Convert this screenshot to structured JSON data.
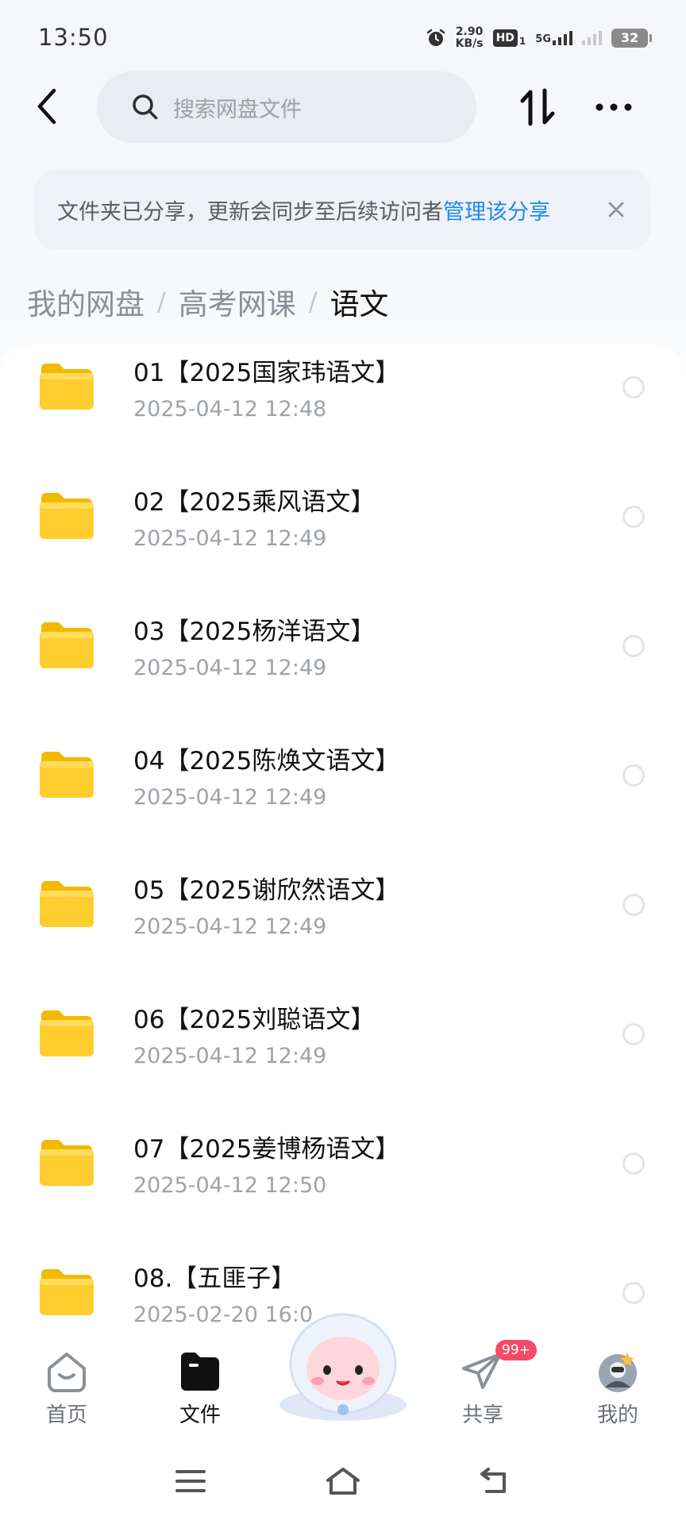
{
  "status_bar": {
    "time": "13:50",
    "net_speed_value": "2.90",
    "net_speed_unit": "KB/s",
    "hd_label": "HD",
    "hd_sub": "1",
    "signal_label": "5G",
    "battery": "32"
  },
  "header": {
    "search_placeholder": "搜索网盘文件"
  },
  "banner": {
    "text": "文件夹已分享，更新会同步至后续访问者",
    "link": "管理该分享"
  },
  "breadcrumb": {
    "items": [
      "我的网盘",
      "高考网课",
      "语文"
    ],
    "separator": "/"
  },
  "files": [
    {
      "name": "01【2025国家玮语文】",
      "date": "2025-04-12  12:48"
    },
    {
      "name": "02【2025乘风语文】",
      "date": "2025-04-12  12:49"
    },
    {
      "name": "03【2025杨洋语文】",
      "date": "2025-04-12  12:49"
    },
    {
      "name": "04【2025陈焕文语文】",
      "date": "2025-04-12  12:49"
    },
    {
      "name": "05【2025谢欣然语文】",
      "date": "2025-04-12  12:49"
    },
    {
      "name": "06【2025刘聪语文】",
      "date": "2025-04-12  12:49"
    },
    {
      "name": "07【2025姜博杨语文】",
      "date": "2025-04-12  12:50"
    },
    {
      "name": "08.【五匪子】",
      "date": "2025-02-20  16:0"
    }
  ],
  "bottom_nav": {
    "items": [
      {
        "label": "首页",
        "icon": "home-icon"
      },
      {
        "label": "文件",
        "icon": "folder-icon",
        "active": true
      },
      {
        "label": "共享",
        "icon": "send-icon",
        "badge": "99+"
      },
      {
        "label": "我的",
        "icon": "avatar"
      }
    ]
  },
  "colors": {
    "accent": "#1c8ae6",
    "folder": "#ffcd2e",
    "badge": "#f24b68"
  }
}
